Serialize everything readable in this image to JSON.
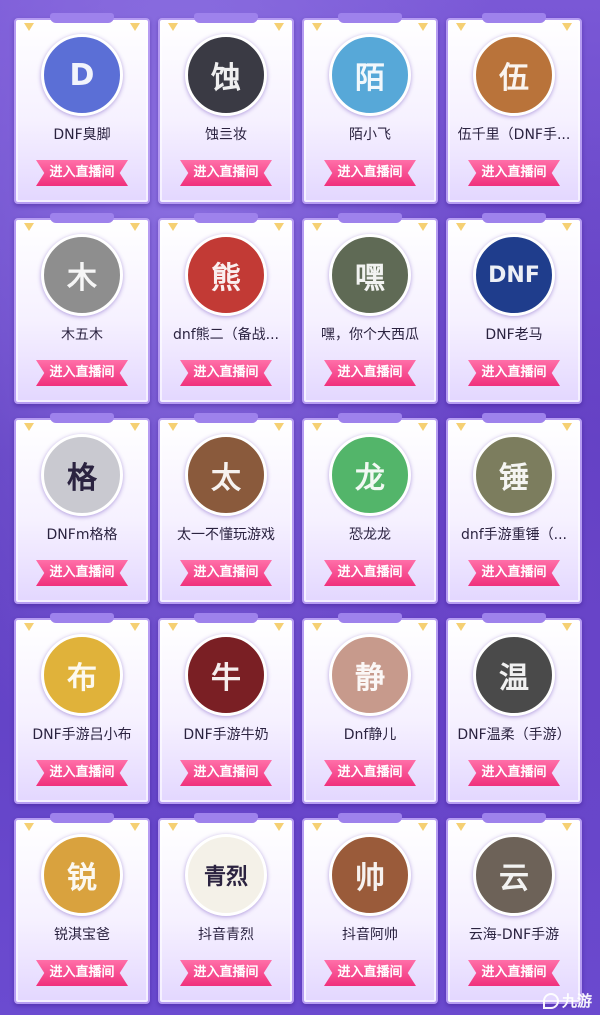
{
  "enter_label": "进入直播间",
  "streamers": [
    {
      "name": "DNF臭脚",
      "avatar_initial": "D",
      "avatar_color": "#5b6fd6"
    },
    {
      "name": "蚀亖妆",
      "avatar_initial": "蚀",
      "avatar_color": "#3a3a44"
    },
    {
      "name": "陌小飞",
      "avatar_initial": "陌",
      "avatar_color": "#57a8d8"
    },
    {
      "name": "伍千里（DNF手...",
      "avatar_initial": "伍",
      "avatar_color": "#b9733a"
    },
    {
      "name": "木五木",
      "avatar_initial": "木",
      "avatar_color": "#8e8e8e"
    },
    {
      "name": "dnf熊二（备战...",
      "avatar_initial": "熊",
      "avatar_color": "#c23a35"
    },
    {
      "name": "嘿，你个大西瓜",
      "avatar_initial": "嘿",
      "avatar_color": "#5f6a55"
    },
    {
      "name": "DNF老马",
      "avatar_initial": "DNF",
      "avatar_color": "#1f3d8c"
    },
    {
      "name": "DNFm格格",
      "avatar_initial": "格",
      "avatar_color": "#c9c9d0"
    },
    {
      "name": "太一不懂玩游戏",
      "avatar_initial": "太",
      "avatar_color": "#8a5a3c"
    },
    {
      "name": "恐龙龙",
      "avatar_initial": "龙",
      "avatar_color": "#53b56a"
    },
    {
      "name": "dnf手游重锤（...",
      "avatar_initial": "锤",
      "avatar_color": "#7c7d5e"
    },
    {
      "name": "DNF手游吕小布",
      "avatar_initial": "布",
      "avatar_color": "#e0b23a"
    },
    {
      "name": "DNF手游牛奶",
      "avatar_initial": "牛",
      "avatar_color": "#7a1f24"
    },
    {
      "name": "Dnf静儿",
      "avatar_initial": "静",
      "avatar_color": "#c79a8c"
    },
    {
      "name": "DNF温柔（手游）",
      "avatar_initial": "温",
      "avatar_color": "#4a4a4a"
    },
    {
      "name": "锐淇宝爸",
      "avatar_initial": "锐",
      "avatar_color": "#d9a23e"
    },
    {
      "name": "抖音青烈",
      "avatar_initial": "青烈",
      "avatar_color": "#f4f1e8"
    },
    {
      "name": "抖音阿帅",
      "avatar_initial": "帅",
      "avatar_color": "#9a5b3a"
    },
    {
      "name": "云海-DNF手游",
      "avatar_initial": "云",
      "avatar_color": "#6d6258"
    }
  ],
  "watermark": "九游"
}
